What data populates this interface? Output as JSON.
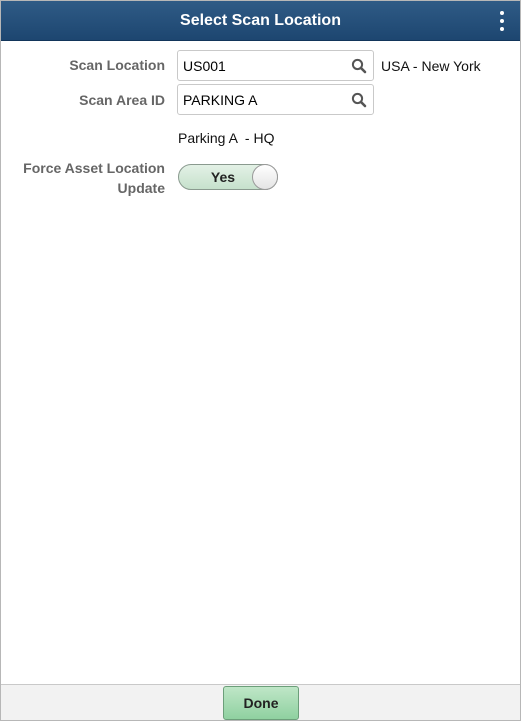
{
  "header": {
    "title": "Select Scan Location",
    "menu_icon": "vertical-ellipsis-icon"
  },
  "form": {
    "scan_location": {
      "label": "Scan Location",
      "value": "US001",
      "description": "USA - New York",
      "icon": "search-icon"
    },
    "scan_area": {
      "label": "Scan Area ID",
      "value": "PARKING A",
      "description": "Parking A  - HQ",
      "icon": "search-icon"
    },
    "force_update": {
      "label_line1": "Force Asset Location",
      "label_line2": "Update",
      "value": "Yes",
      "on": true
    }
  },
  "footer": {
    "done_label": "Done"
  },
  "colors": {
    "header": "#1d4670",
    "toggle_on": "#c6e1cc",
    "done_button": "#8fd1a0"
  }
}
